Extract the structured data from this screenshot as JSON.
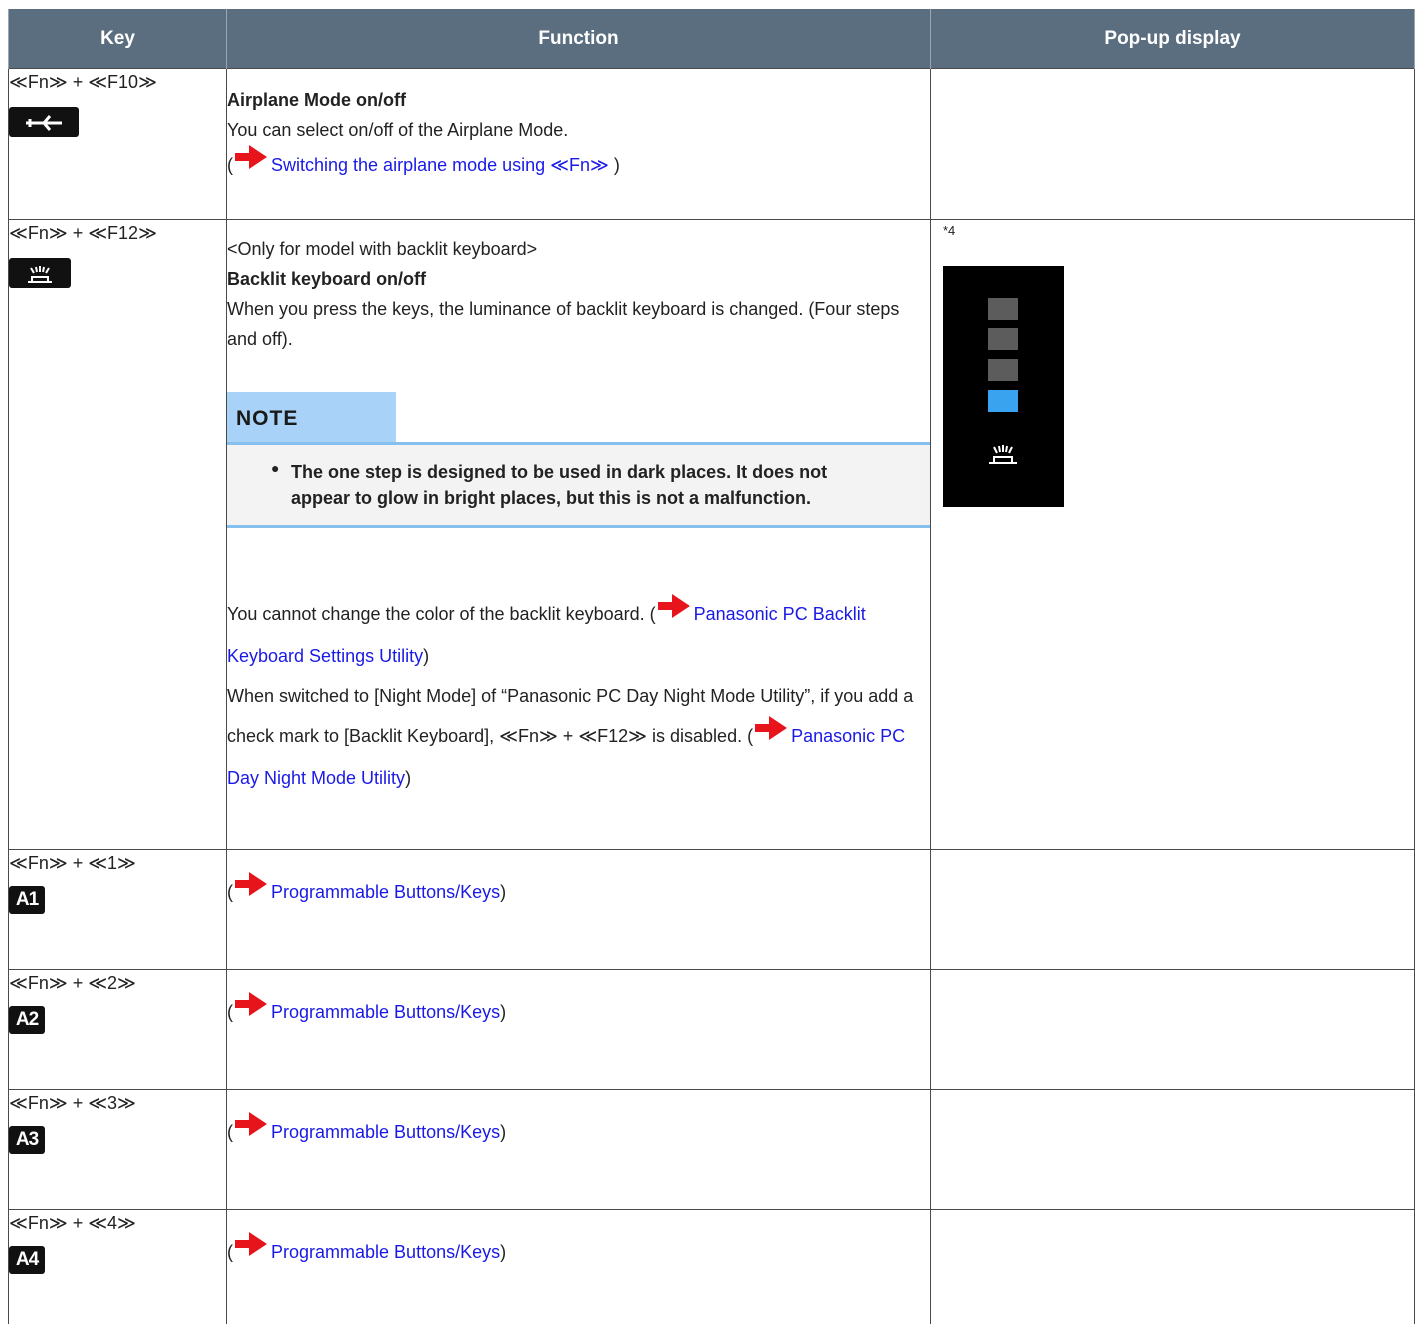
{
  "header": {
    "key": "Key",
    "function": "Function",
    "popup": "Pop-up display"
  },
  "rows": [
    {
      "key_text": "≪Fn≫ + ≪F10≫",
      "icon": "airplane-icon",
      "title": "Airplane Mode on/off",
      "desc": "You can select on/off of the Airplane Mode.",
      "link_text": "Switching the airplane mode using ≪Fn≫"
    },
    {
      "key_text": "≪Fn≫ + ≪F12≫",
      "icon": "backlit-keyboard-icon",
      "pre": "<Only for model with backlit keyboard>",
      "title": "Backlit keyboard on/off",
      "desc": "When you press the keys, the luminance of backlit keyboard is changed. (Four steps and off).",
      "note_label": "NOTE",
      "note_text": "The one step is designed to be used in dark places. It does not appear to glow in bright places, but this is not a malfunction.",
      "color_text": "You cannot change the color of the backlit keyboard. (",
      "color_link": "Panasonic PC Backlit Keyboard Settings Utility",
      "night_text": "When switched to [Night Mode] of “Panasonic PC Day Night Mode Utility”, if you add a check mark to [Backlit Keyboard], ≪Fn≫ + ≪F12≫ is disabled. (",
      "night_link": "Panasonic PC Day Night Mode Utility",
      "footnote": "*4",
      "popup_levels": {
        "total": 4,
        "lit": 1
      }
    },
    {
      "key_text": "≪Fn≫ + ≪1≫",
      "icon_label": "A1",
      "link_text": "Programmable Buttons/Keys"
    },
    {
      "key_text": "≪Fn≫ + ≪2≫",
      "icon_label": "A2",
      "link_text": "Programmable Buttons/Keys"
    },
    {
      "key_text": "≪Fn≫ + ≪3≫",
      "icon_label": "A3",
      "link_text": "Programmable Buttons/Keys"
    },
    {
      "key_text": "≪Fn≫ + ≪4≫",
      "icon_label": "A4",
      "link_text": "Programmable Buttons/Keys"
    }
  ],
  "punct": {
    "open": "(",
    "close": ")",
    "close_space": " )"
  },
  "colors": {
    "header_bg": "#5a6e80",
    "link": "#1a1ae6",
    "arrow": "#e8141c",
    "note_head": "#a8d2f7",
    "popup_lit": "#3aa3f0"
  }
}
